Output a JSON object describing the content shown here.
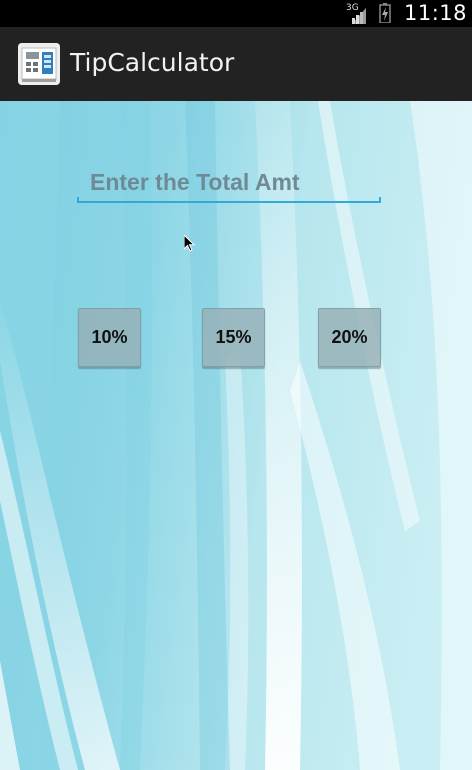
{
  "status_bar": {
    "network": "3G",
    "time": "11:18"
  },
  "action_bar": {
    "title": "TipCalculator",
    "icon": "calculator-icon"
  },
  "form": {
    "total_amount": {
      "value": "",
      "placeholder": "Enter the Total Amt"
    },
    "tip_buttons": [
      {
        "label": "10%"
      },
      {
        "label": "15%"
      },
      {
        "label": "20%"
      }
    ]
  },
  "colors": {
    "action_bar": "#222222",
    "input_underline": "#33a9d8",
    "background_tint": "#7fd0e0"
  }
}
